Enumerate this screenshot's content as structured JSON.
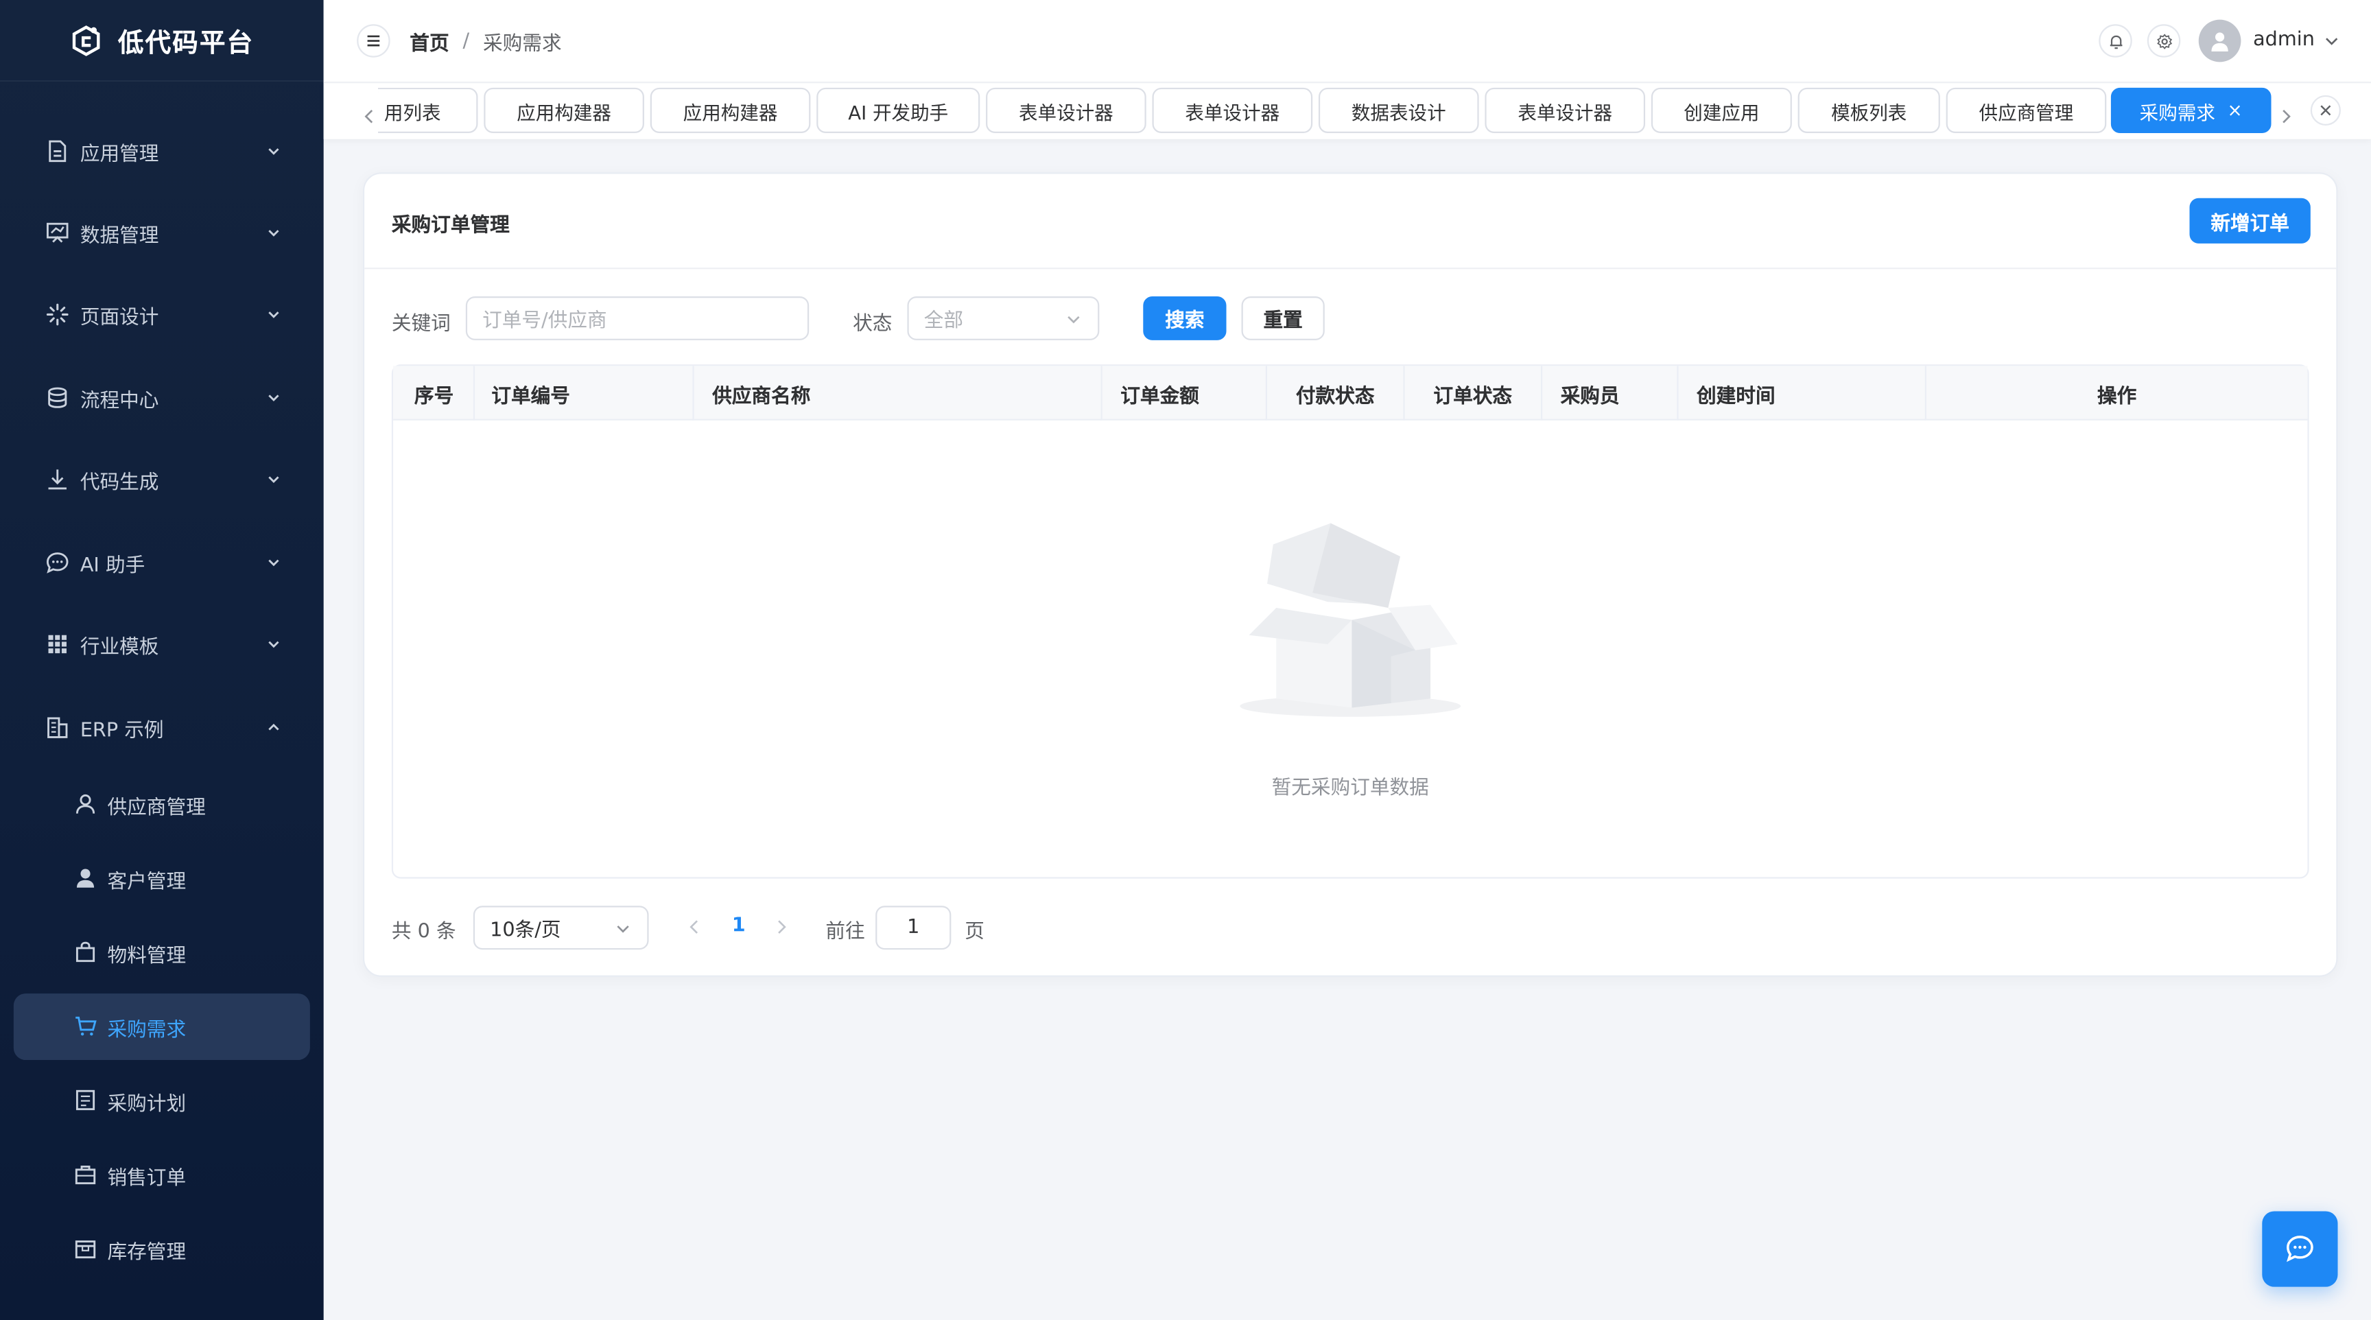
{
  "app": {
    "title": "低代码平台",
    "brand_color": "#1e88f5",
    "sidebar_bg": "#12233f"
  },
  "sidebar": {
    "menus": [
      {
        "label": "应用管理",
        "icon": "document-icon",
        "arrow": "chevron-down-icon"
      },
      {
        "label": "数据管理",
        "icon": "monitor-icon",
        "arrow": "chevron-down-icon"
      },
      {
        "label": "页面设计",
        "icon": "loading-icon",
        "arrow": "chevron-down-icon"
      },
      {
        "label": "流程中心",
        "icon": "coin-stack-icon",
        "arrow": "chevron-down-icon"
      },
      {
        "label": "代码生成",
        "icon": "download-icon",
        "arrow": "chevron-down-icon"
      },
      {
        "label": "AI 助手",
        "icon": "chat-icon",
        "arrow": "chevron-down-icon"
      },
      {
        "label": "行业模板",
        "icon": "grid-icon",
        "arrow": "chevron-down-icon"
      },
      {
        "label": "ERP 示例",
        "icon": "office-building-icon",
        "arrow": "chevron-up-icon"
      }
    ],
    "sub_items": [
      {
        "label": "供应商管理",
        "icon": "user-icon"
      },
      {
        "label": "客户管理",
        "icon": "user-filled-icon"
      },
      {
        "label": "物料管理",
        "icon": "handbag-icon"
      },
      {
        "label": "采购需求",
        "icon": "cart-icon",
        "active": true
      },
      {
        "label": "采购计划",
        "icon": "tickets-icon"
      },
      {
        "label": "销售订单",
        "icon": "briefcase-icon"
      },
      {
        "label": "库存管理",
        "icon": "box-icon"
      }
    ]
  },
  "header": {
    "breadcrumb": {
      "home": "首页",
      "separator": "/",
      "current": "采购需求"
    },
    "user": {
      "name": "admin"
    }
  },
  "tabs": [
    {
      "label": "用列表"
    },
    {
      "label": "应用构建器"
    },
    {
      "label": "应用构建器"
    },
    {
      "label": "AI 开发助手"
    },
    {
      "label": "表单设计器"
    },
    {
      "label": "表单设计器"
    },
    {
      "label": "数据表设计"
    },
    {
      "label": "表单设计器"
    },
    {
      "label": "创建应用"
    },
    {
      "label": "模板列表"
    },
    {
      "label": "供应商管理"
    },
    {
      "label": "采购需求",
      "active": true,
      "close": "×"
    }
  ],
  "main": {
    "card_title": "采购订单管理",
    "new_order_label": "新增订单",
    "filters": {
      "keyword_label": "关键词",
      "keyword_placeholder": "订单号/供应商",
      "status_label": "状态",
      "status_value": "全部",
      "search_label": "搜索",
      "reset_label": "重置"
    },
    "table": {
      "columns": [
        "序号",
        "订单编号",
        "供应商名称",
        "订单金额",
        "付款状态",
        "订单状态",
        "采购员",
        "创建时间",
        "操作"
      ],
      "rows": [],
      "empty_text": "暂无采购订单数据"
    },
    "pagination": {
      "total_text": "共 0 条",
      "page_size": "10条/页",
      "current_page": "1",
      "goto_label": "前往",
      "goto_value": "1",
      "page_suffix": "页"
    }
  }
}
